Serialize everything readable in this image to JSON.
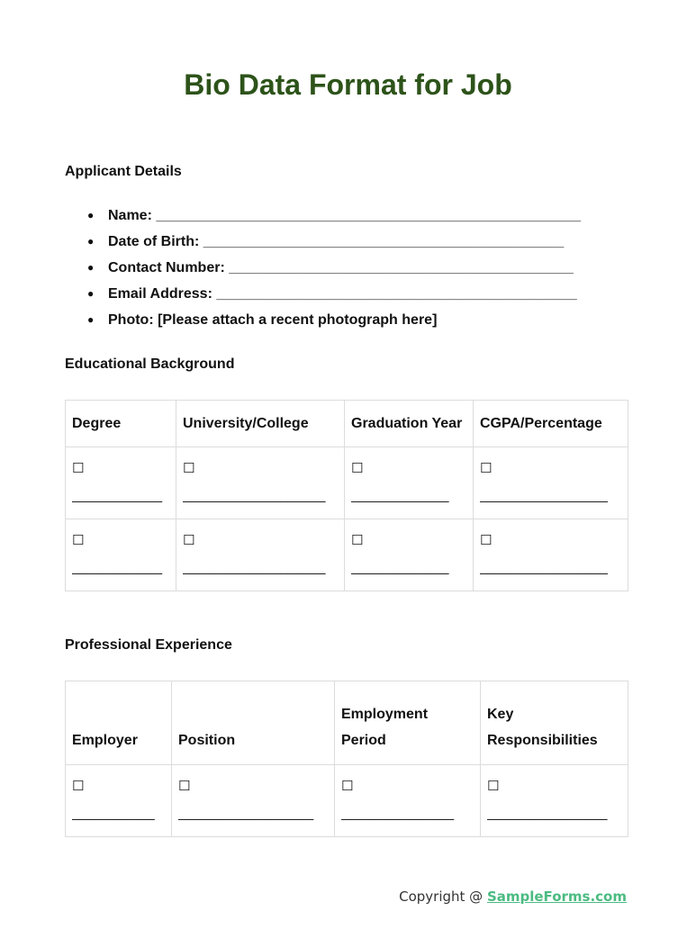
{
  "document": {
    "title": "Bio Data Format for Job",
    "title_color": "#2d531a"
  },
  "applicant_details": {
    "heading": "Applicant Details",
    "bullet": "●",
    "items": [
      {
        "label": "Name:",
        "blank": "_____________________________________________________"
      },
      {
        "label": "Date of Birth:",
        "blank": "_____________________________________________"
      },
      {
        "label": "Contact Number:",
        "blank": "___________________________________________"
      },
      {
        "label": "Email Address:",
        "blank": "_____________________________________________"
      },
      {
        "label": "Photo: [Please attach a recent photograph here]",
        "blank": ""
      }
    ]
  },
  "educational_background": {
    "heading": "Educational Background",
    "columns": [
      "Degree",
      "University/College",
      "Graduation Year",
      "CGPA/Percentage"
    ],
    "rows": [
      [
        {
          "box": "☐",
          "line": "____________"
        },
        {
          "box": "☐",
          "line": "___________________"
        },
        {
          "box": "☐",
          "line": "_____________"
        },
        {
          "box": "☐",
          "line": "_________________"
        }
      ],
      [
        {
          "box": "☐",
          "line": "____________"
        },
        {
          "box": "☐",
          "line": "___________________"
        },
        {
          "box": "☐",
          "line": "_____________"
        },
        {
          "box": "☐",
          "line": "_________________"
        }
      ]
    ]
  },
  "professional_experience": {
    "heading": "Professional Experience",
    "columns": [
      "Employer",
      "Position",
      "Employment Period",
      "Key Responsibilities"
    ],
    "rows": [
      [
        {
          "box": "☐",
          "line": "___________"
        },
        {
          "box": "☐",
          "line": "__________________"
        },
        {
          "box": "☐",
          "line": "_______________"
        },
        {
          "box": "☐",
          "line": "________________"
        }
      ]
    ]
  },
  "footer": {
    "prefix": "Copyright @ ",
    "brand": "SampleForms.com",
    "brand_color": "#4cbb82"
  }
}
